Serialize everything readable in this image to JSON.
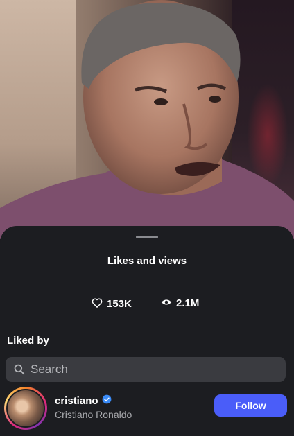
{
  "video": {
    "background": "person speaking, video frame"
  },
  "sheet": {
    "title": "Likes and views",
    "likes": "153K",
    "views": "2.1M",
    "section_title": "Liked by"
  },
  "search": {
    "placeholder": "Search"
  },
  "liked_users": [
    {
      "username": "cristiano",
      "full_name": "Cristiano Ronaldo",
      "verified": true,
      "action_label": "Follow"
    }
  ],
  "colors": {
    "sheet_bg": "#1c1d21",
    "search_bg": "#3a3b40",
    "follow_button": "#4a5df9",
    "verified_badge": "#3a8bf7"
  },
  "icons": [
    "heart-icon",
    "eye-icon",
    "search-icon",
    "verified-badge-icon"
  ]
}
